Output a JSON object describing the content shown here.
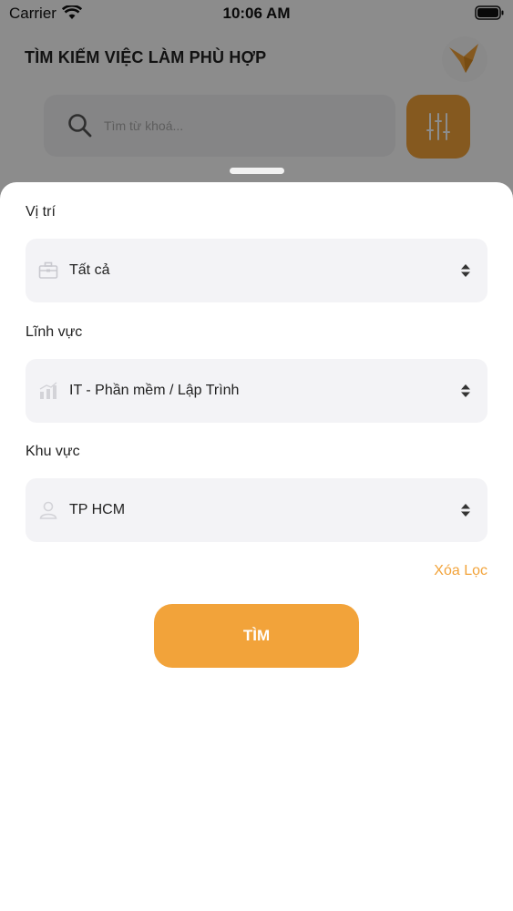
{
  "status_bar": {
    "carrier": "Carrier",
    "time": "10:06 AM"
  },
  "header": {
    "title": "TÌM KIẾM VIỆC LÀM PHÙ HỢP",
    "logo_icon": "bird-logo-icon"
  },
  "search": {
    "placeholder": "Tìm từ khoá...",
    "icon": "search-icon",
    "filter_icon": "sliders-icon"
  },
  "filter_sheet": {
    "position": {
      "label": "Vị trí",
      "value": "Tất cả",
      "icon": "briefcase-icon"
    },
    "field": {
      "label": "Lĩnh vực",
      "value": "IT - Phần mềm / Lập Trình",
      "icon": "bar-chart-icon"
    },
    "area": {
      "label": "Khu vực",
      "value": "TP HCM",
      "icon": "user-icon"
    },
    "clear_label": "Xóa Lọc",
    "submit_label": "TÌM"
  },
  "colors": {
    "accent": "#f2a33a",
    "field_bg": "#f3f3f6",
    "text": "#222222"
  }
}
